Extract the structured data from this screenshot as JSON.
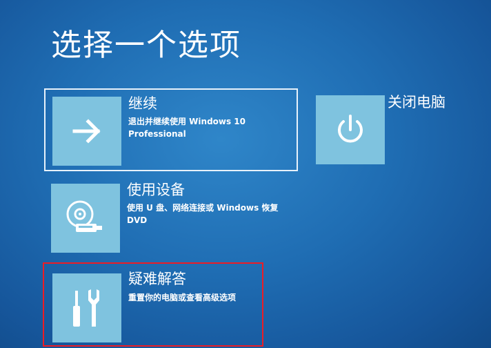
{
  "screen": {
    "title": "选择一个选项"
  },
  "options": {
    "continue": {
      "label": "继续",
      "description": "退出并继续使用 Windows 10 Professional",
      "icon": "arrow-right-icon"
    },
    "use_device": {
      "label": "使用设备",
      "description": "使用 U 盘、网络连接或 Windows 恢复 DVD",
      "icon": "disc-drive-icon"
    },
    "troubleshoot": {
      "label": "疑难解答",
      "description": "重置你的电脑或查看高级选项",
      "icon": "tools-icon"
    },
    "shutdown": {
      "label": "关闭电脑",
      "icon": "power-icon"
    }
  },
  "colors": {
    "background": "#1f6db3",
    "tile": "#7fc3df",
    "highlight_border": "#ee1c24",
    "focus_border": "#e8f2fb"
  }
}
